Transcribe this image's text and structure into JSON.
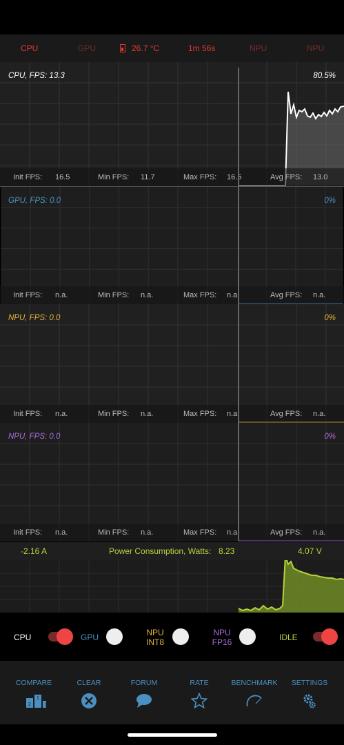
{
  "topbar": {
    "cpu": "CPU",
    "gpu": "GPU",
    "temperature": "26.7 °C",
    "elapsed": "1m 56s",
    "npu1": "NPU",
    "npu2": "NPU"
  },
  "panels": [
    {
      "title": "CPU, FPS:  13.3",
      "percent": "80.5%",
      "color": "#ffffff",
      "init_label": "Init FPS:",
      "init": "16.5",
      "min_label": "Min FPS:",
      "min": "11.7",
      "max_label": "Max FPS:",
      "max": "16.5",
      "avg_label": "Avg FPS:",
      "avg": "13.0"
    },
    {
      "title": "GPU, FPS:  0.0",
      "percent": "0%",
      "color": "#4a90c0",
      "init_label": "Init FPS:",
      "init": "n.a.",
      "min_label": "Min FPS:",
      "min": "n.a.",
      "max_label": "Max FPS:",
      "max": "n.a.",
      "avg_label": "Avg FPS:",
      "avg": "n.a."
    },
    {
      "title": "NPU, FPS:  0.0",
      "percent": "0%",
      "color": "#e2b33a",
      "init_label": "Init FPS:",
      "init": "n.a.",
      "min_label": "Min FPS:",
      "min": "n.a.",
      "max_label": "Max FPS:",
      "max": "n.a.",
      "avg_label": "Avg FPS:",
      "avg": "n.a."
    },
    {
      "title": "NPU, FPS:  0.0",
      "percent": "0%",
      "color": "#a86ad6",
      "init_label": "Init FPS:",
      "init": "n.a.",
      "min_label": "Min FPS:",
      "min": "n.a.",
      "max_label": "Max FPS:",
      "max": "n.a.",
      "avg_label": "Avg FPS:",
      "avg": "n.a."
    }
  ],
  "power": {
    "current": "-2.16 A",
    "label": "Power Consumption, Watts:",
    "watts": "8.23",
    "voltage": "4.07 V"
  },
  "toggles": {
    "cpu": {
      "label": "CPU",
      "on": true
    },
    "gpu": {
      "label": "GPU",
      "on": false
    },
    "npu_int8": {
      "label_line1": "NPU",
      "label_line2": "INT8",
      "on": false
    },
    "npu_fp16": {
      "label_line1": "NPU",
      "label_line2": "FP16",
      "on": false
    },
    "idle": {
      "label": "IDLE",
      "on": true
    }
  },
  "nav": {
    "compare": "COMPARE",
    "clear": "CLEAR",
    "forum": "FORUM",
    "rate": "RATE",
    "benchmark": "BENCHMARK",
    "settings": "SETTINGS"
  },
  "colors": {
    "red": "#e53935",
    "cpu_line": "#ffffff",
    "gpu": "#4a90c0",
    "npu_int8": "#e2b33a",
    "npu_fp16": "#a86ad6",
    "power": "#b6d33b",
    "switch_on": "#ef4444"
  },
  "icons": {
    "compare": "podium-icon",
    "clear": "clear-x-icon",
    "forum": "chat-bubble-icon",
    "rate": "star-icon",
    "benchmark": "gauge-icon",
    "settings": "gears-icon",
    "battery": "battery-icon"
  }
}
